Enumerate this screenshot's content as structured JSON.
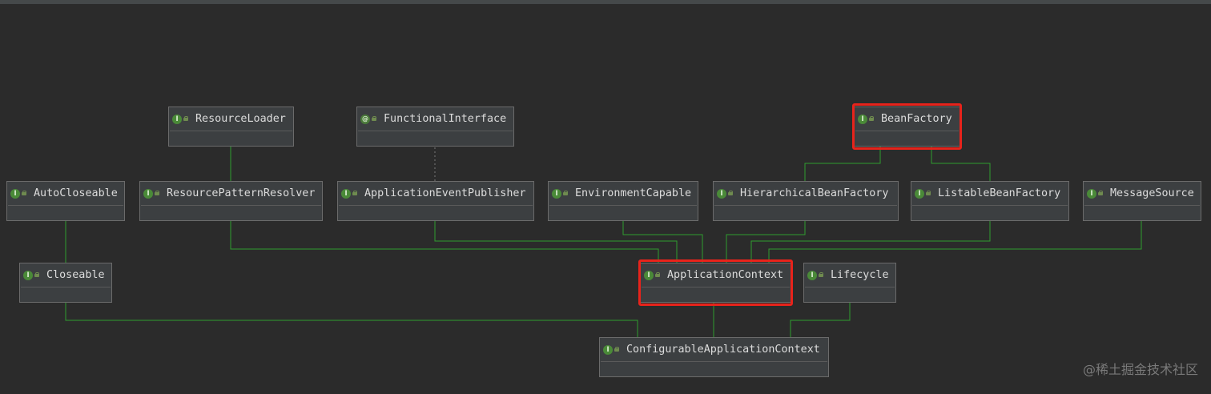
{
  "diagram": {
    "nodes": [
      {
        "id": "ResourceLoader",
        "label": "ResourceLoader",
        "icon": "interface-icon"
      },
      {
        "id": "FunctionalInterface",
        "label": "FunctionalInterface",
        "icon": "annotation-icon"
      },
      {
        "id": "BeanFactory",
        "label": "BeanFactory",
        "icon": "interface-icon",
        "highlighted": true
      },
      {
        "id": "AutoCloseable",
        "label": "AutoCloseable",
        "icon": "interface-icon"
      },
      {
        "id": "ResourcePatternResolver",
        "label": "ResourcePatternResolver",
        "icon": "interface-icon"
      },
      {
        "id": "ApplicationEventPublisher",
        "label": "ApplicationEventPublisher",
        "icon": "interface-icon"
      },
      {
        "id": "EnvironmentCapable",
        "label": "EnvironmentCapable",
        "icon": "interface-icon"
      },
      {
        "id": "HierarchicalBeanFactory",
        "label": "HierarchicalBeanFactory",
        "icon": "interface-icon"
      },
      {
        "id": "ListableBeanFactory",
        "label": "ListableBeanFactory",
        "icon": "interface-icon"
      },
      {
        "id": "MessageSource",
        "label": "MessageSource",
        "icon": "interface-icon"
      },
      {
        "id": "Closeable",
        "label": "Closeable",
        "icon": "interface-icon"
      },
      {
        "id": "ApplicationContext",
        "label": "ApplicationContext",
        "icon": "interface-icon",
        "highlighted": true
      },
      {
        "id": "Lifecycle",
        "label": "Lifecycle",
        "icon": "interface-icon"
      },
      {
        "id": "ConfigurableApplicationContext",
        "label": "ConfigurableApplicationContext",
        "icon": "interface-icon"
      }
    ],
    "edges": [
      {
        "from": "ResourcePatternResolver",
        "to": "ResourceLoader",
        "kind": "extends"
      },
      {
        "from": "ApplicationEventPublisher",
        "to": "FunctionalInterface",
        "kind": "annotated"
      },
      {
        "from": "HierarchicalBeanFactory",
        "to": "BeanFactory",
        "kind": "extends"
      },
      {
        "from": "ListableBeanFactory",
        "to": "BeanFactory",
        "kind": "extends"
      },
      {
        "from": "Closeable",
        "to": "AutoCloseable",
        "kind": "extends"
      },
      {
        "from": "ApplicationContext",
        "to": "ResourcePatternResolver",
        "kind": "extends"
      },
      {
        "from": "ApplicationContext",
        "to": "ApplicationEventPublisher",
        "kind": "extends"
      },
      {
        "from": "ApplicationContext",
        "to": "EnvironmentCapable",
        "kind": "extends"
      },
      {
        "from": "ApplicationContext",
        "to": "HierarchicalBeanFactory",
        "kind": "extends"
      },
      {
        "from": "ApplicationContext",
        "to": "ListableBeanFactory",
        "kind": "extends"
      },
      {
        "from": "ApplicationContext",
        "to": "MessageSource",
        "kind": "extends"
      },
      {
        "from": "ConfigurableApplicationContext",
        "to": "ApplicationContext",
        "kind": "extends"
      },
      {
        "from": "ConfigurableApplicationContext",
        "to": "Closeable",
        "kind": "extends"
      },
      {
        "from": "ConfigurableApplicationContext",
        "to": "Lifecycle",
        "kind": "extends"
      }
    ]
  },
  "watermark": "@稀土掘金技术社区",
  "colors": {
    "background": "#2b2b2b",
    "node_fill": "#3c3f41",
    "node_border": "#6b6b6b",
    "edge": "#2f9e2f",
    "annotation_edge": "#7a7a7a",
    "highlight": "#e8231b",
    "interface_icon": "#4a8a38"
  }
}
